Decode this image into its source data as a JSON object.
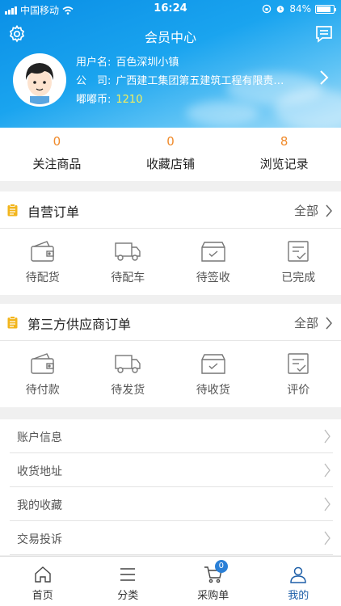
{
  "status_bar": {
    "carrier": "中国移动",
    "time": "16:24",
    "battery": "84%",
    "battery_level": 0.84
  },
  "header": {
    "title": "会员中心"
  },
  "profile": {
    "username_label": "用户名:",
    "username": "百色深圳小镇",
    "company_label": "公　司:",
    "company": "广西建工集团第五建筑工程有限责…",
    "coins_label": "嘟嘟币:",
    "coins": "1210"
  },
  "stats": [
    {
      "count": "0",
      "label": "关注商品"
    },
    {
      "count": "0",
      "label": "收藏店铺"
    },
    {
      "count": "8",
      "label": "浏览记录"
    }
  ],
  "self_orders": {
    "title": "自营订单",
    "all_label": "全部",
    "items": [
      {
        "icon": "wallet-icon",
        "label": "待配货"
      },
      {
        "icon": "truck-icon",
        "label": "待配车"
      },
      {
        "icon": "box-icon",
        "label": "待签收"
      },
      {
        "icon": "checklist-icon",
        "label": "已完成"
      }
    ]
  },
  "third_orders": {
    "title": "第三方供应商订单",
    "all_label": "全部",
    "items": [
      {
        "icon": "wallet-icon",
        "label": "待付款"
      },
      {
        "icon": "truck-icon",
        "label": "待发货"
      },
      {
        "icon": "box-icon",
        "label": "待收货"
      },
      {
        "icon": "checklist-icon",
        "label": "评价"
      }
    ]
  },
  "menu": [
    {
      "label": "账户信息"
    },
    {
      "label": "收货地址"
    },
    {
      "label": "我的收藏"
    },
    {
      "label": "交易投诉"
    }
  ],
  "tabs": [
    {
      "icon": "home-icon",
      "label": "首页"
    },
    {
      "icon": "list-icon",
      "label": "分类"
    },
    {
      "icon": "cart-icon",
      "label": "采购单",
      "badge": "0"
    },
    {
      "icon": "user-icon",
      "label": "我的"
    }
  ],
  "colors": {
    "accent": "#f08a2a",
    "header_blue": "#0a8fe6",
    "active_tab": "#1e5fa8",
    "coins": "#f6ef5a"
  }
}
